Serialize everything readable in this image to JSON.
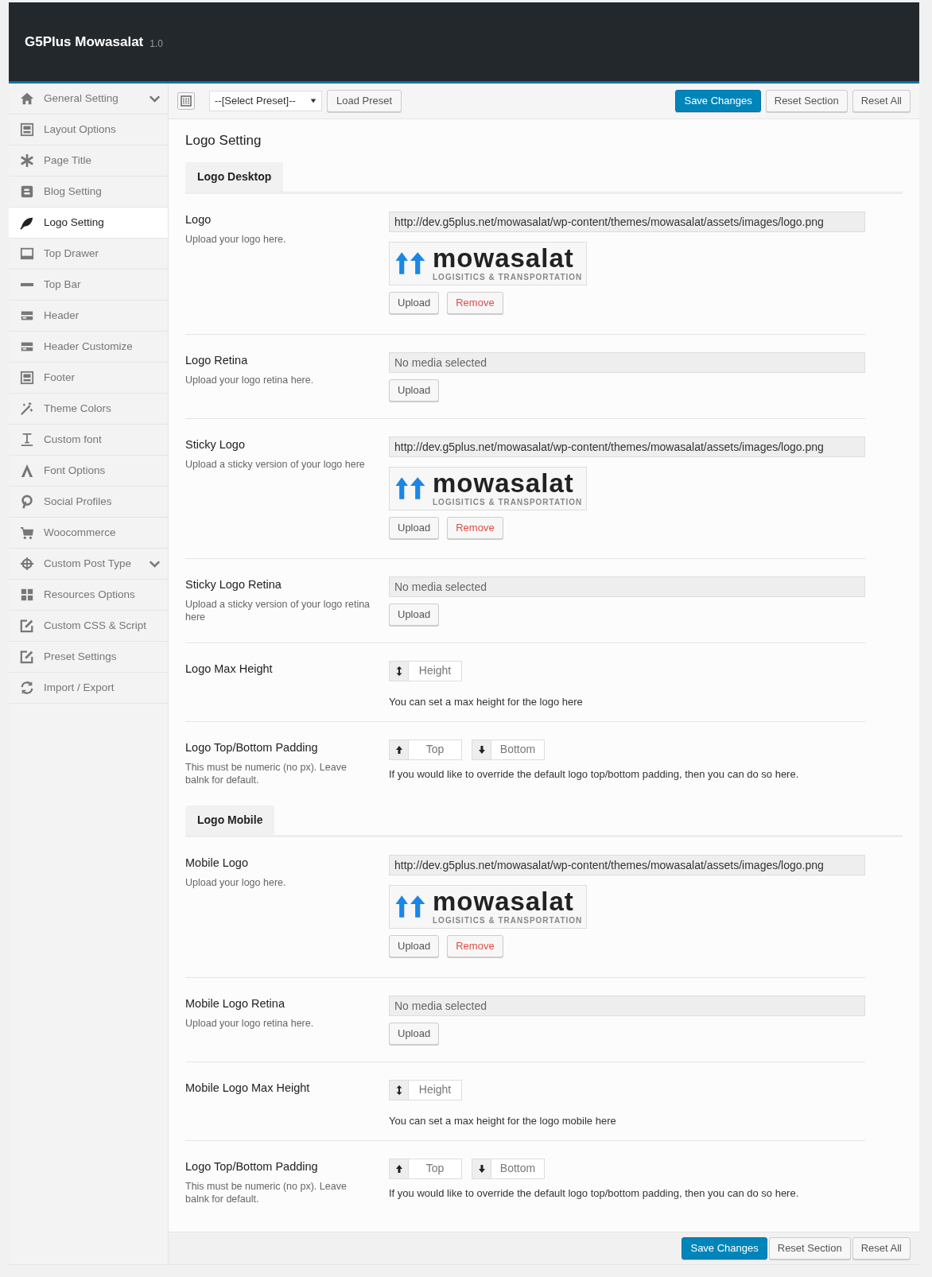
{
  "header": {
    "title": "G5Plus Mowasalat",
    "version": "1.0"
  },
  "sidebar": {
    "items": [
      {
        "label": "General Setting",
        "selected": false,
        "expandable": true
      },
      {
        "label": "Layout Options",
        "selected": false,
        "expandable": false
      },
      {
        "label": "Page Title",
        "selected": false,
        "expandable": false
      },
      {
        "label": "Blog Setting",
        "selected": false,
        "expandable": false
      },
      {
        "label": "Logo Setting",
        "selected": true,
        "expandable": false
      },
      {
        "label": "Top Drawer",
        "selected": false,
        "expandable": false
      },
      {
        "label": "Top Bar",
        "selected": false,
        "expandable": false
      },
      {
        "label": "Header",
        "selected": false,
        "expandable": false
      },
      {
        "label": "Header Customize",
        "selected": false,
        "expandable": false
      },
      {
        "label": "Footer",
        "selected": false,
        "expandable": false
      },
      {
        "label": "Theme Colors",
        "selected": false,
        "expandable": false
      },
      {
        "label": "Custom font",
        "selected": false,
        "expandable": false
      },
      {
        "label": "Font Options",
        "selected": false,
        "expandable": false
      },
      {
        "label": "Social Profiles",
        "selected": false,
        "expandable": false
      },
      {
        "label": "Woocommerce",
        "selected": false,
        "expandable": false
      },
      {
        "label": "Custom Post Type",
        "selected": false,
        "expandable": true
      },
      {
        "label": "Resources Options",
        "selected": false,
        "expandable": false
      },
      {
        "label": "Custom CSS & Script",
        "selected": false,
        "expandable": false
      },
      {
        "label": "Preset Settings",
        "selected": false,
        "expandable": false
      },
      {
        "label": "Import / Export",
        "selected": false,
        "expandable": false
      }
    ]
  },
  "toolbar": {
    "preset_select": "--[Select Preset]--",
    "load_button": "Load Preset",
    "buttons": [
      {
        "label": "Save Changes",
        "kind": "primary"
      },
      {
        "label": "Reset Section",
        "kind": "default"
      },
      {
        "label": "Reset All",
        "kind": "default"
      }
    ]
  },
  "page_title": "Logo Setting",
  "sections": [
    {
      "tab": "Logo Desktop",
      "fields": [
        {
          "kind": "media",
          "label": "Logo",
          "description": "Upload your logo here.",
          "value": "http://dev.g5plus.net/mowasalat/wp-content/themes/mowasalat/assets/images/logo.png",
          "preview": {
            "wordmark": "mowasalat",
            "tagline": "LOGISITICS & TRANSPORTATION"
          },
          "buttons": [
            {
              "label": "Upload",
              "kind": "default"
            },
            {
              "label": "Remove",
              "kind": "danger"
            }
          ]
        },
        {
          "kind": "media",
          "label": "Logo Retina",
          "description": "Upload your logo retina here.",
          "placeholder": "No media selected",
          "buttons": [
            {
              "label": "Upload",
              "kind": "default"
            }
          ]
        },
        {
          "kind": "media",
          "label": "Sticky Logo",
          "description": "Upload a sticky version of your logo here",
          "value": "http://dev.g5plus.net/mowasalat/wp-content/themes/mowasalat/assets/images/logo.png",
          "preview": {
            "wordmark": "mowasalat",
            "tagline": "LOGISITICS & TRANSPORTATION"
          },
          "buttons": [
            {
              "label": "Upload",
              "kind": "default"
            },
            {
              "label": "Remove",
              "kind": "danger"
            }
          ]
        },
        {
          "kind": "media",
          "label": "Sticky Logo Retina",
          "description": "Upload a sticky version of your logo retina here",
          "placeholder": "No media selected",
          "buttons": [
            {
              "label": "Upload",
              "kind": "default"
            }
          ]
        },
        {
          "kind": "dimension",
          "label": "Logo Max Height",
          "inputs": [
            {
              "kind": "height",
              "placeholder": "Height"
            }
          ],
          "help": "You can set a max height for the logo here"
        },
        {
          "kind": "dimension",
          "label": "Logo Top/Bottom Padding",
          "description": "This must be numeric (no px). Leave balnk for default.",
          "inputs": [
            {
              "kind": "up",
              "placeholder": "Top"
            },
            {
              "kind": "down",
              "placeholder": "Bottom"
            }
          ],
          "help": "If you would like to override the default logo top/bottom padding, then you can do so here."
        }
      ]
    },
    {
      "tab": "Logo Mobile",
      "fields": [
        {
          "kind": "media",
          "label": "Mobile Logo",
          "description": "Upload your logo here.",
          "value": "http://dev.g5plus.net/mowasalat/wp-content/themes/mowasalat/assets/images/logo.png",
          "preview": {
            "wordmark": "mowasalat",
            "tagline": "LOGISITICS & TRANSPORTATION"
          },
          "buttons": [
            {
              "label": "Upload",
              "kind": "default"
            },
            {
              "label": "Remove",
              "kind": "danger"
            }
          ]
        },
        {
          "kind": "media",
          "label": "Mobile Logo Retina",
          "description": "Upload your logo retina here.",
          "placeholder": "No media selected",
          "buttons": [
            {
              "label": "Upload",
              "kind": "default"
            }
          ]
        },
        {
          "kind": "dimension",
          "label": "Mobile Logo Max Height",
          "inputs": [
            {
              "kind": "height",
              "placeholder": "Height"
            }
          ],
          "help": "You can set a max height for the logo mobile here"
        },
        {
          "kind": "dimension",
          "label": "Logo Top/Bottom Padding",
          "description": "This must be numeric (no px). Leave balnk for default.",
          "inputs": [
            {
              "kind": "up",
              "placeholder": "Top"
            },
            {
              "kind": "down",
              "placeholder": "Bottom"
            }
          ],
          "help": "If you would like to override the default logo top/bottom padding, then you can do so here."
        }
      ]
    }
  ],
  "footer": {
    "buttons": [
      {
        "label": "Save Changes",
        "kind": "primary"
      },
      {
        "label": "Reset Section",
        "kind": "default"
      },
      {
        "label": "Reset All",
        "kind": "default"
      }
    ]
  }
}
